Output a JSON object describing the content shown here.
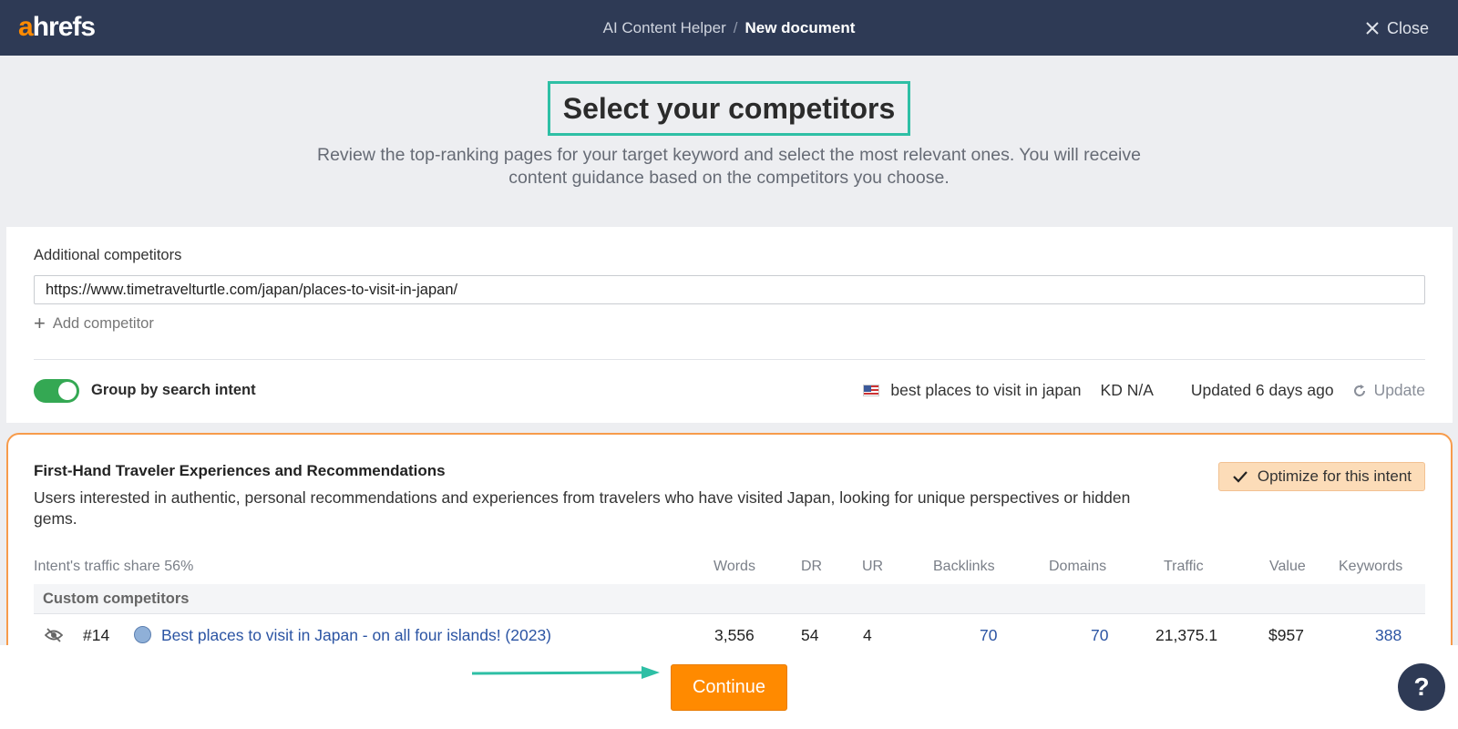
{
  "header": {
    "logo_a": "a",
    "logo_rest": "hrefs",
    "breadcrumb_parent": "AI Content Helper",
    "breadcrumb_sep": "/",
    "breadcrumb_current": "New document",
    "close_label": "Close"
  },
  "heading": {
    "title": "Select your competitors",
    "subtitle": "Review the top-ranking pages for your target keyword and select the most relevant ones. You will receive content guidance based on the competitors you choose."
  },
  "competitors": {
    "label": "Additional competitors",
    "url_value": "https://www.timetravelturtle.com/japan/places-to-visit-in-japan/",
    "add_label": "Add competitor"
  },
  "controls": {
    "group_label": "Group by search intent",
    "group_enabled": true,
    "keyword": "best places to visit in japan",
    "kd": "KD N/A",
    "updated": "Updated 6 days ago",
    "update_label": "Update"
  },
  "intent": {
    "title": "First-Hand Traveler Experiences and Recommendations",
    "description": "Users interested in authentic, personal recommendations and experiences from travelers who have visited Japan, looking for unique perspectives or hidden gems.",
    "optimize_label": "Optimize for this intent",
    "traffic_share": "Intent's traffic share 56%",
    "columns": {
      "words": "Words",
      "dr": "DR",
      "ur": "UR",
      "backlinks": "Backlinks",
      "domains": "Domains",
      "traffic": "Traffic",
      "value": "Value",
      "keywords": "Keywords"
    },
    "group_name": "Custom competitors",
    "rows": [
      {
        "rank": "#14",
        "title": "Best places to visit in Japan - on all four islands! (2023)",
        "words": "3,556",
        "dr": "54",
        "ur": "4",
        "backlinks": "70",
        "domains": "70",
        "traffic": "21,375.1",
        "value": "$957",
        "keywords": "388"
      }
    ]
  },
  "footer": {
    "continue_label": "Continue",
    "help_label": "?"
  },
  "colors": {
    "header_bg": "#2e3a55",
    "accent_orange": "#ff8a00",
    "teal_highlight": "#2ebfa5",
    "toggle_green": "#34a853",
    "link_blue": "#2b54a3"
  }
}
